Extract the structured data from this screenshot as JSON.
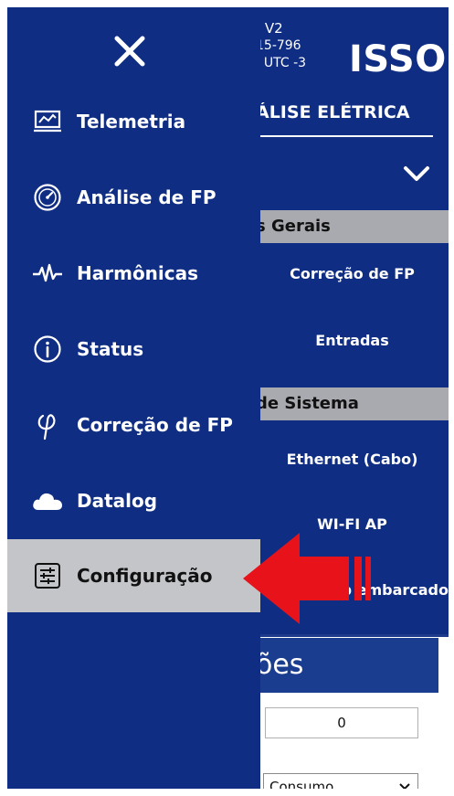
{
  "colors": {
    "navy": "#0f2d82",
    "active_bg": "#c4c5c9",
    "group_header_bg": "#a9aab0",
    "arrow": "#e8131a",
    "text_light": "#ffffff"
  },
  "device": {
    "line1": "; V2",
    "line2": "15-796",
    "line3": ". UTC -3",
    "logo": "ISSO"
  },
  "page": {
    "section_title": "ÁLISE ELÉTRICA",
    "expand_icon": "chevron-down-icon",
    "groups": [
      {
        "header": "s Gerais",
        "links": [
          "Correção de FP",
          "Entradas"
        ]
      },
      {
        "header": "de Sistema",
        "links": [
          "Ethernet (Cabo)",
          "WI-FI AP",
          "b embarcado"
        ]
      }
    ],
    "panel": {
      "title": "ões",
      "input_value": "0",
      "select_value": "Consumo"
    }
  },
  "sidebar": {
    "close_icon": "close-icon",
    "items": [
      {
        "label": "Telemetria",
        "icon": "monitor-chart-icon",
        "active": false
      },
      {
        "label": "Análise de FP",
        "icon": "gauge-icon",
        "active": false
      },
      {
        "label": "Harmônicas",
        "icon": "waveform-icon",
        "active": false
      },
      {
        "label": "Status",
        "icon": "info-icon",
        "active": false
      },
      {
        "label": "Correção de FP",
        "icon": "phi-icon",
        "active": false
      },
      {
        "label": "Datalog",
        "icon": "cloud-icon",
        "active": false
      },
      {
        "label": "Configuração",
        "icon": "sliders-icon",
        "active": true
      }
    ]
  },
  "annotation": {
    "icon": "red-arrow-icon"
  }
}
